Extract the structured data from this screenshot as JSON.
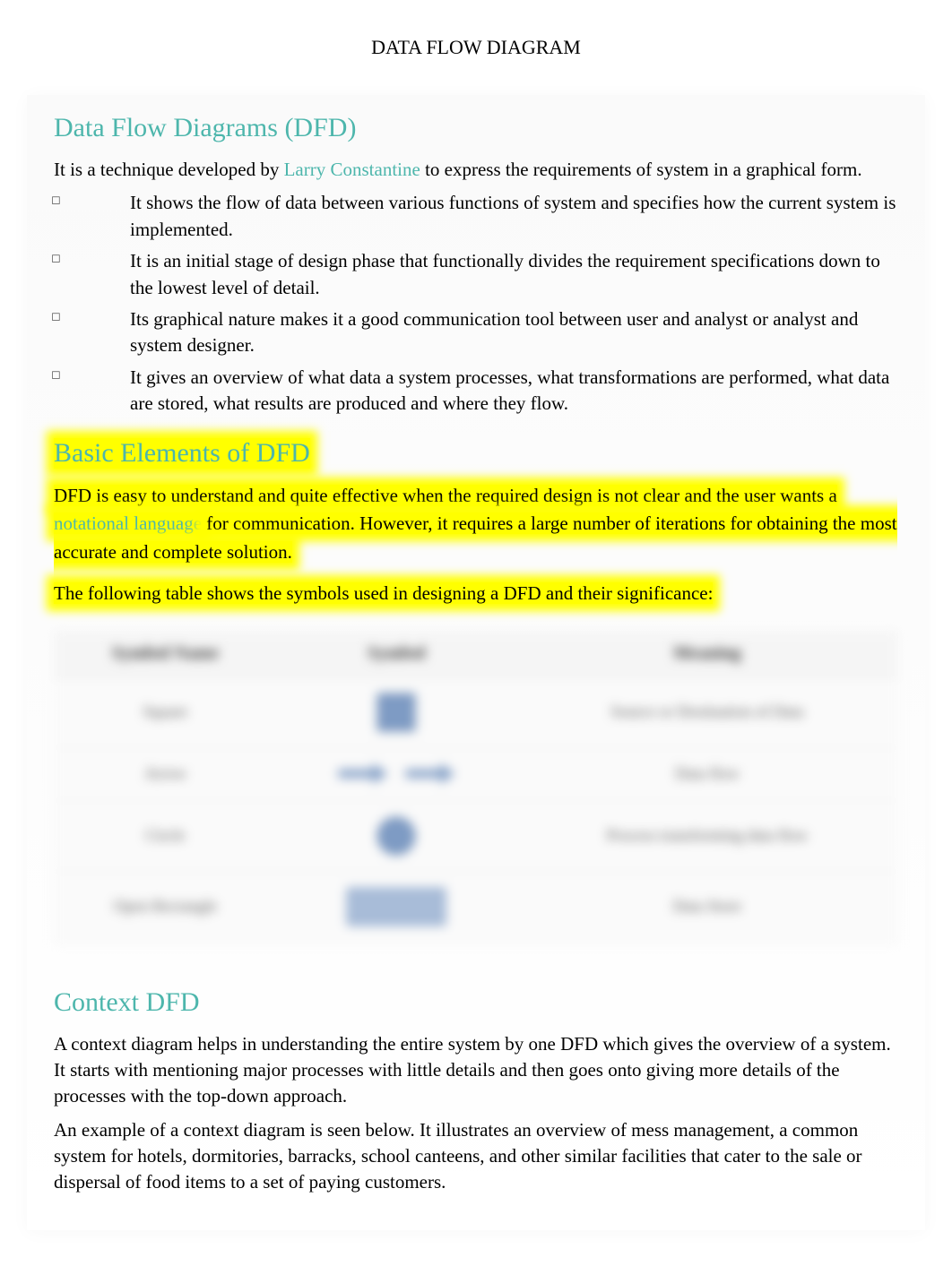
{
  "page_title": "DATA FLOW DIAGRAM",
  "section1": {
    "heading": "Data Flow Diagrams (DFD)",
    "intro_before": "It is a technique developed by ",
    "intro_link": "Larry Constantine",
    "intro_after": " to express the requirements of system in a graphical form.",
    "bullets": [
      "It shows the flow of data between various functions of system and specifies how the current system is implemented.",
      "It is an initial stage of design phase that functionally divides the requirement specifications down to the lowest level of detail.",
      "Its graphical nature makes it a good communication tool between user and analyst or analyst and system designer.",
      "It gives an overview of what data a system processes, what transformations are performed, what data are stored, what results are produced and where they flow."
    ]
  },
  "section2": {
    "heading": "Basic Elements of DFD",
    "para1_before": "DFD is easy to understand and quite effective when the required design is not clear and the user wants a ",
    "para1_link": "notational language",
    "para1_after": " for communication. However, it requires a large number of iterations for obtaining the most accurate and complete solution.",
    "para2": "The following table shows the symbols used in designing a DFD and their significance:",
    "table": {
      "headers": [
        "Symbol Name",
        "Symbol",
        "Meaning"
      ],
      "rows": [
        {
          "name": "Square",
          "meaning": "Source or Destination of Data"
        },
        {
          "name": "Arrow",
          "meaning": "Data flow"
        },
        {
          "name": "Circle",
          "meaning": "Process transforming data flow"
        },
        {
          "name": "Open Rectangle",
          "meaning": "Data Store"
        }
      ]
    }
  },
  "section3": {
    "heading": "Context DFD",
    "para1": "A context diagram helps in understanding the entire system by one DFD which gives the overview of a system. It starts with mentioning major processes with little details and then goes onto giving more details of the processes with the top-down approach.",
    "para2": "An example of a context diagram is seen below. It illustrates an overview of mess management, a common system for hotels, dormitories, barracks, school canteens, and other similar facilities that cater to the sale or dispersal of food items to a set of paying customers."
  }
}
